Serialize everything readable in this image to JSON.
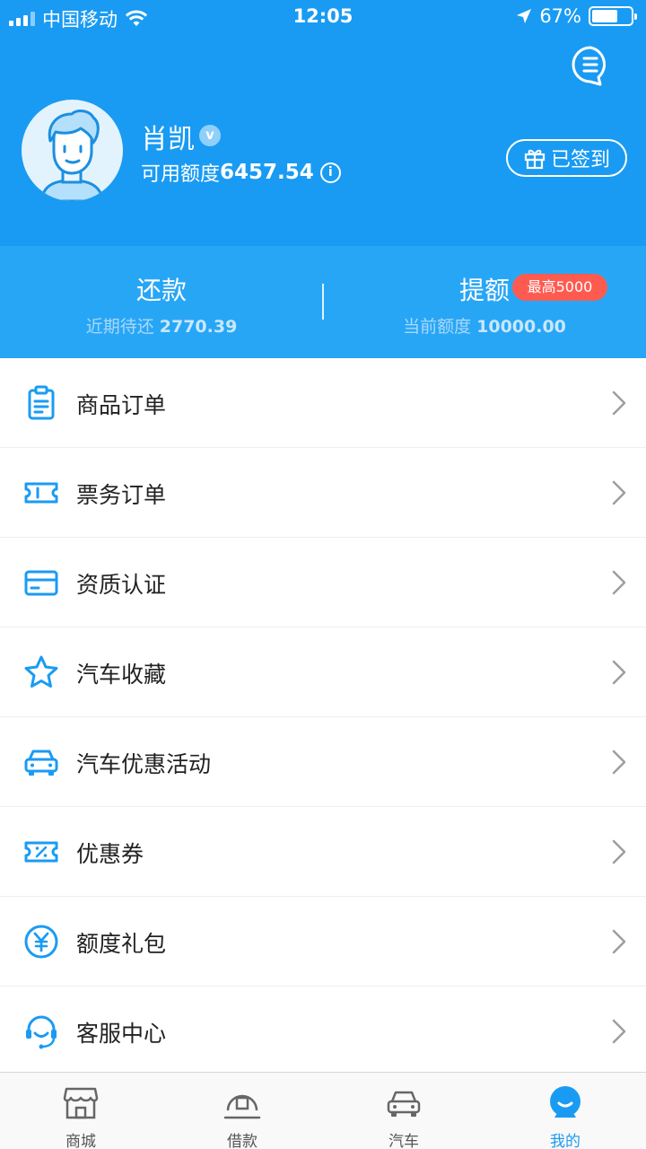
{
  "status_bar": {
    "carrier": "中国移动",
    "time": "12:05",
    "battery": "67%",
    "battery_level": 0.67
  },
  "profile": {
    "name": "肖凯",
    "verified_badge": "v",
    "credit_label": "可用额度",
    "credit_value": "6457.54",
    "info_icon": "i",
    "signed_label": "已签到"
  },
  "summary": {
    "repay": {
      "title": "还款",
      "desc": "近期待还",
      "amount": "2770.39"
    },
    "raise": {
      "title": "提额",
      "badge": "最高5000",
      "desc": "当前额度",
      "amount": "10000.00"
    }
  },
  "menu": [
    {
      "label": "商品订单",
      "icon": "clipboard-icon"
    },
    {
      "label": "票务订单",
      "icon": "ticket-icon"
    },
    {
      "label": "资质认证",
      "icon": "card-icon"
    },
    {
      "label": "汽车收藏",
      "icon": "star-icon"
    },
    {
      "label": "汽车优惠活动",
      "icon": "car-icon"
    },
    {
      "label": "优惠券",
      "icon": "coupon-icon"
    },
    {
      "label": "额度礼包",
      "icon": "yen-icon"
    },
    {
      "label": "客服中心",
      "icon": "headset-icon"
    }
  ],
  "tabbar": [
    {
      "label": "商城",
      "icon": "store-icon",
      "active": false
    },
    {
      "label": "借款",
      "icon": "loan-icon",
      "active": false
    },
    {
      "label": "汽车",
      "icon": "car-icon",
      "active": false
    },
    {
      "label": "我的",
      "icon": "profile-icon",
      "active": true
    }
  ],
  "colors": {
    "header_bg": "#199bf3",
    "subheader_bg": "#28a6f6",
    "accent": "#1a9bf3",
    "badge_red": "#fe5b50"
  }
}
